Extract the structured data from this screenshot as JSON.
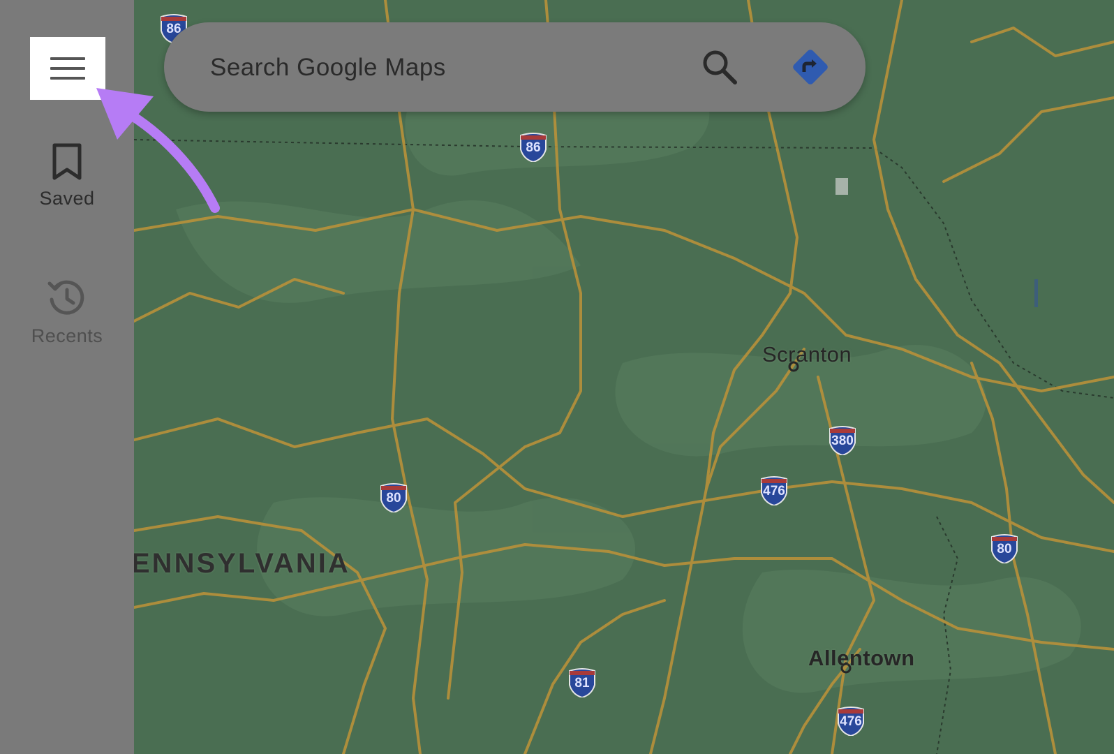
{
  "search": {
    "placeholder": "Search Google Maps"
  },
  "sidebar": {
    "menu_icon": "hamburger-menu-icon",
    "items": [
      {
        "label": "Saved",
        "icon": "bookmark-icon"
      },
      {
        "label": "Recents",
        "icon": "history-icon"
      }
    ]
  },
  "map": {
    "places": [
      "Scranton",
      "Allentown"
    ],
    "state_label": "ENNSYLVANIA",
    "route_shields": [
      "86",
      "86",
      "80",
      "380",
      "476",
      "80",
      "81",
      "476"
    ]
  },
  "colors": {
    "map_background": "#4a6e52",
    "road": "#b8913a",
    "sidebar": "#7a7a7a",
    "highlight_arrow": "#b67cf5",
    "directions_button": "#2f5bb0"
  }
}
